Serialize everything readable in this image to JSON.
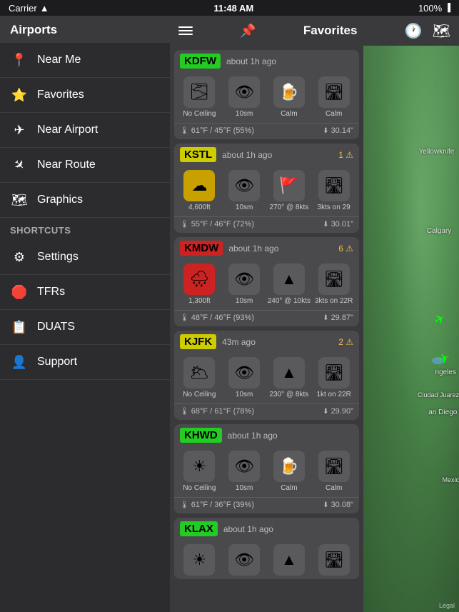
{
  "status_bar": {
    "carrier": "Carrier",
    "wifi_icon": "wifi",
    "time": "11:48 AM",
    "battery": "100%"
  },
  "sidebar": {
    "airports_header": "Airports",
    "items": [
      {
        "id": "near-me",
        "label": "Near Me",
        "icon": "📍"
      },
      {
        "id": "favorites",
        "label": "Favorites",
        "icon": "⭐"
      },
      {
        "id": "near-airport",
        "label": "Near Airport",
        "icon": "✈"
      },
      {
        "id": "near-route",
        "label": "Near Route",
        "icon": "✈"
      },
      {
        "id": "graphics",
        "label": "Graphics",
        "icon": "🗺"
      }
    ],
    "shortcuts_header": "Shortcuts",
    "shortcut_items": [
      {
        "id": "settings",
        "label": "Settings",
        "icon": "⚙"
      },
      {
        "id": "tfrs",
        "label": "TFRs",
        "icon": "🛑"
      },
      {
        "id": "duats",
        "label": "DUATS",
        "icon": "📋"
      },
      {
        "id": "support",
        "label": "Support",
        "icon": "👤"
      }
    ]
  },
  "top_nav": {
    "title": "Favorites",
    "hamburger_label": "menu",
    "pin_icon": "📌",
    "clock_icon": "🕐",
    "map_icon": "🗺"
  },
  "airports": [
    {
      "code": "KDFW",
      "code_color": "#22cc22",
      "time_ago": "about 1h ago",
      "alerts": null,
      "wx_icons": [
        {
          "icon": "🌫",
          "bg": "gray",
          "label": "No Ceiling"
        },
        {
          "icon": "👁",
          "bg": "gray",
          "label": "10sm"
        },
        {
          "icon": "🍺",
          "bg": "gray",
          "label": "Calm"
        },
        {
          "icon": "🛣",
          "bg": "gray",
          "label": "Calm"
        }
      ],
      "footer_left_icon": "🌡",
      "footer_left": "61°F / 45°F (55%)",
      "footer_right_icon": "⬇",
      "footer_right": "30.14\""
    },
    {
      "code": "KSTL",
      "code_color": "#cccc00",
      "time_ago": "about 1h ago",
      "alerts": "1 ⚠",
      "wx_icons": [
        {
          "icon": "☁",
          "bg": "yellow",
          "label": "4,600ft"
        },
        {
          "icon": "👁",
          "bg": "gray",
          "label": "10sm"
        },
        {
          "icon": "🚩",
          "bg": "gray",
          "label": "270° @ 8kts"
        },
        {
          "icon": "🛣",
          "bg": "gray",
          "label": "3kts on 29"
        }
      ],
      "footer_left_icon": "🌡",
      "footer_left": "55°F / 46°F (72%)",
      "footer_right_icon": "⬇",
      "footer_right": "30.01\""
    },
    {
      "code": "KMDW",
      "code_color": "#cc2222",
      "time_ago": "about 1h ago",
      "alerts": "6 ⚠",
      "wx_icons": [
        {
          "icon": "🌧",
          "bg": "red",
          "label": "1,300ft"
        },
        {
          "icon": "👁",
          "bg": "gray",
          "label": "10sm"
        },
        {
          "icon": "▲",
          "bg": "gray",
          "label": "240° @ 10kts"
        },
        {
          "icon": "🛣",
          "bg": "gray",
          "label": "3kts on 22R"
        }
      ],
      "footer_left_icon": "🌡",
      "footer_left": "48°F / 46°F (93%)",
      "footer_right_icon": "⬇",
      "footer_right": "29.87\""
    },
    {
      "code": "KJFK",
      "code_color": "#cccc00",
      "time_ago": "43m ago",
      "alerts": "2 ⚠",
      "wx_icons": [
        {
          "icon": "🌥",
          "bg": "gray",
          "label": "No Ceiling"
        },
        {
          "icon": "👁",
          "bg": "gray",
          "label": "10sm"
        },
        {
          "icon": "▲",
          "bg": "gray",
          "label": "230° @ 8kts"
        },
        {
          "icon": "🛣",
          "bg": "gray",
          "label": "1kt on 22R"
        }
      ],
      "footer_left_icon": "🌡",
      "footer_left": "68°F / 61°F (78%)",
      "footer_right_icon": "⬇",
      "footer_right": "29.90\""
    },
    {
      "code": "KHWD",
      "code_color": "#22cc22",
      "time_ago": "about 1h ago",
      "alerts": null,
      "wx_icons": [
        {
          "icon": "☀",
          "bg": "gray",
          "label": "No Ceiling"
        },
        {
          "icon": "👁",
          "bg": "gray",
          "label": "10sm"
        },
        {
          "icon": "🍺",
          "bg": "gray",
          "label": "Calm"
        },
        {
          "icon": "🛣",
          "bg": "gray",
          "label": "Calm"
        }
      ],
      "footer_left_icon": "🌡",
      "footer_left": "61°F / 36°F (39%)",
      "footer_right_icon": "⬇",
      "footer_right": "30.08\""
    },
    {
      "code": "KLAX",
      "code_color": "#22cc22",
      "time_ago": "about 1h ago",
      "alerts": null,
      "wx_icons": [
        {
          "icon": "☀",
          "bg": "gray",
          "label": ""
        },
        {
          "icon": "👁",
          "bg": "gray",
          "label": ""
        },
        {
          "icon": "▲",
          "bg": "gray",
          "label": ""
        },
        {
          "icon": "🛣",
          "bg": "gray",
          "label": ""
        }
      ],
      "footer_left_icon": "",
      "footer_left": "",
      "footer_right_icon": "",
      "footer_right": ""
    }
  ],
  "map": {
    "labels": [
      {
        "text": "Yellowknife",
        "top": "18%",
        "right": "5%"
      },
      {
        "text": "Calgary",
        "top": "32%",
        "right": "8%"
      },
      {
        "text": "ngeles",
        "top": "57%",
        "right": "3%"
      },
      {
        "text": "an Diego",
        "top": "65%",
        "right": "2%"
      },
      {
        "text": "Ciudad Juarez",
        "top": "60%",
        "right": "0%"
      },
      {
        "text": "Mexic",
        "top": "75%",
        "right": "0%"
      }
    ],
    "planes": [
      {
        "top": "47%",
        "right": "14%",
        "rotation": "-30deg"
      },
      {
        "top": "53%",
        "right": "10%",
        "rotation": "0deg"
      }
    ],
    "legal": "Legal"
  }
}
